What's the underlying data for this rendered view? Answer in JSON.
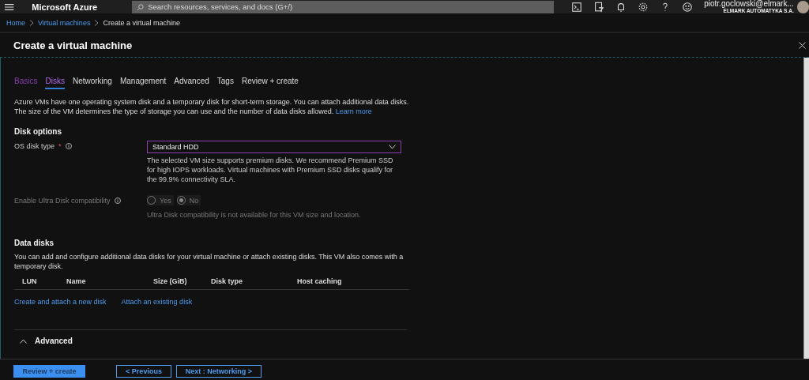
{
  "top_bar": {
    "brand": "Microsoft Azure",
    "search": {
      "placeholder": "Search resources, services, and docs (G+/)"
    },
    "account": {
      "email": "piotr.goclowski@elmark...",
      "org": "ELMARK AUTOMATYKA S.A."
    }
  },
  "breadcrumb": [
    "Home",
    "Virtual machines",
    "Create a virtual machine"
  ],
  "blade": {
    "title": "Create a virtual machine"
  },
  "tabs": [
    {
      "label": "Basics",
      "selected": false,
      "visited": true
    },
    {
      "label": "Disks",
      "selected": true,
      "visited": false
    },
    {
      "label": "Networking",
      "selected": false,
      "visited": false
    },
    {
      "label": "Management",
      "selected": false,
      "visited": false
    },
    {
      "label": "Advanced",
      "selected": false,
      "visited": false
    },
    {
      "label": "Tags",
      "selected": false,
      "visited": false
    },
    {
      "label": "Review + create",
      "selected": false,
      "visited": false
    }
  ],
  "intro": {
    "text": "Azure VMs have one operating system disk and a temporary disk for short-term storage. You can attach additional data disks. The size of the VM determines the type of storage you can use and the number of data disks allowed.",
    "link": "Learn more"
  },
  "disk_options": {
    "heading": "Disk options",
    "os_disk_type": {
      "label": "OS disk type",
      "required_mark": "*",
      "value": "Standard HDD",
      "hint": "The selected VM size supports premium disks. We recommend Premium SSD for high IOPS workloads. Virtual machines with Premium SSD disks qualify for the 99.9% connectivity SLA."
    },
    "ultra_disk": {
      "label": "Enable Ultra Disk compatibility",
      "disabled": true,
      "options": [
        {
          "label": "Yes",
          "selected": false
        },
        {
          "label": "No",
          "selected": true
        }
      ],
      "hint": "Ultra Disk compatibility is not available for this VM size and location."
    }
  },
  "data_disks": {
    "heading": "Data disks",
    "text": "You can add and configure additional data disks for your virtual machine or attach existing disks. This VM also comes with a temporary disk.",
    "columns": [
      "LUN",
      "Name",
      "Size (GiB)",
      "Disk type",
      "Host caching"
    ],
    "links": [
      "Create and attach a new disk",
      "Attach an existing disk"
    ]
  },
  "advanced": {
    "title": "Advanced",
    "expanded": true
  },
  "footer": {
    "buttons": [
      {
        "label": "Review + create",
        "kind": "primary"
      },
      {
        "label": "< Previous",
        "kind": "secondary"
      },
      {
        "label": "Next : Networking >",
        "kind": "secondary"
      }
    ]
  }
}
